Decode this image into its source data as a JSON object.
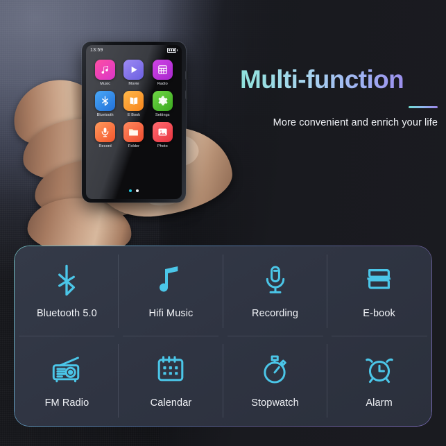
{
  "headline": {
    "title": "Multi-function",
    "subtitle": "More convenient and enrich your life",
    "gradient_start": "#8fe3dc",
    "gradient_end": "#9c85e8"
  },
  "device": {
    "status_time": "13:59",
    "battery_icon": "battery-full-icon",
    "apps": [
      {
        "label": "Music",
        "icon": "music-note-icon",
        "color_start": "#ff4fa3",
        "color_end": "#d935c9"
      },
      {
        "label": "Movie",
        "icon": "play-icon",
        "color_start": "#8f7bf0",
        "color_end": "#6b5fe0"
      },
      {
        "label": "Radio",
        "icon": "radio-grid-icon",
        "color_start": "#c93ce0",
        "color_end": "#a928cd"
      },
      {
        "label": "Bluetooth",
        "icon": "bluetooth-icon",
        "color_start": "#3b9cf5",
        "color_end": "#2170d8"
      },
      {
        "label": "E Book",
        "icon": "open-book-icon",
        "color_start": "#ffae3c",
        "color_end": "#f7851d"
      },
      {
        "label": "Settings",
        "icon": "gear-icon",
        "color_start": "#64cc3c",
        "color_end": "#3aa81f"
      },
      {
        "label": "Record",
        "icon": "microphone-icon",
        "color_start": "#ff8a4c",
        "color_end": "#f4542c"
      },
      {
        "label": "Folder",
        "icon": "folder-icon",
        "color_start": "#ff7b52",
        "color_end": "#ee4a2e"
      },
      {
        "label": "Photo",
        "icon": "photo-icon",
        "color_start": "#ff5f63",
        "color_end": "#e8333f"
      }
    ],
    "page_dots": [
      {
        "state": "active",
        "color": "#22c7e0"
      },
      {
        "state": "inactive",
        "color": "#eceef2"
      }
    ]
  },
  "features": [
    {
      "label": "Bluetooth 5.0",
      "icon": "bluetooth-icon"
    },
    {
      "label": "Hifi Music",
      "icon": "music-note-icon"
    },
    {
      "label": "Recording",
      "icon": "microphone-icon"
    },
    {
      "label": "E-book",
      "icon": "books-icon"
    },
    {
      "label": "FM Radio",
      "icon": "radio-icon"
    },
    {
      "label": "Calendar",
      "icon": "calendar-icon"
    },
    {
      "label": "Stopwatch",
      "icon": "stopwatch-icon"
    },
    {
      "label": "Alarm",
      "icon": "alarm-clock-icon"
    }
  ],
  "theme": {
    "feature_icon_color": "#4bc6e8",
    "panel_border_start": "#7fd9d6",
    "panel_border_end": "#8c7bd4",
    "background": "#141519"
  }
}
